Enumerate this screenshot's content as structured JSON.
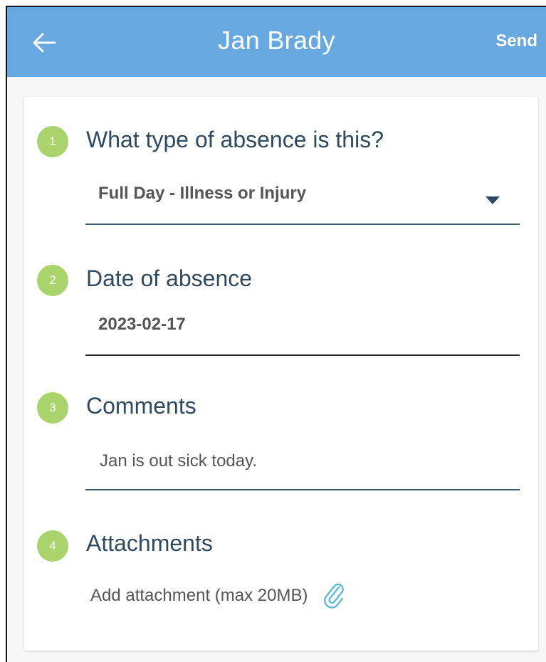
{
  "header": {
    "title": "Jan Brady",
    "send_label": "Send",
    "back_icon": "arrow-left-icon",
    "background_color": "#66a8df"
  },
  "form": {
    "step_color": "#a9d36b",
    "question_color": "#2f4a5e",
    "questions": [
      {
        "number": "1",
        "label": "What type of absence is this?",
        "value": "Full Day - Illness or Injury",
        "control": "select"
      },
      {
        "number": "2",
        "label": "Date of absence",
        "value": "2023-02-17",
        "control": "date"
      },
      {
        "number": "3",
        "label": "Comments",
        "value": "Jan is out sick today.",
        "control": "text"
      },
      {
        "number": "4",
        "label": "Attachments",
        "action_label": "Add attachment (max 20MB)",
        "action_icon": "paperclip-icon",
        "control": "attachment"
      }
    ]
  }
}
